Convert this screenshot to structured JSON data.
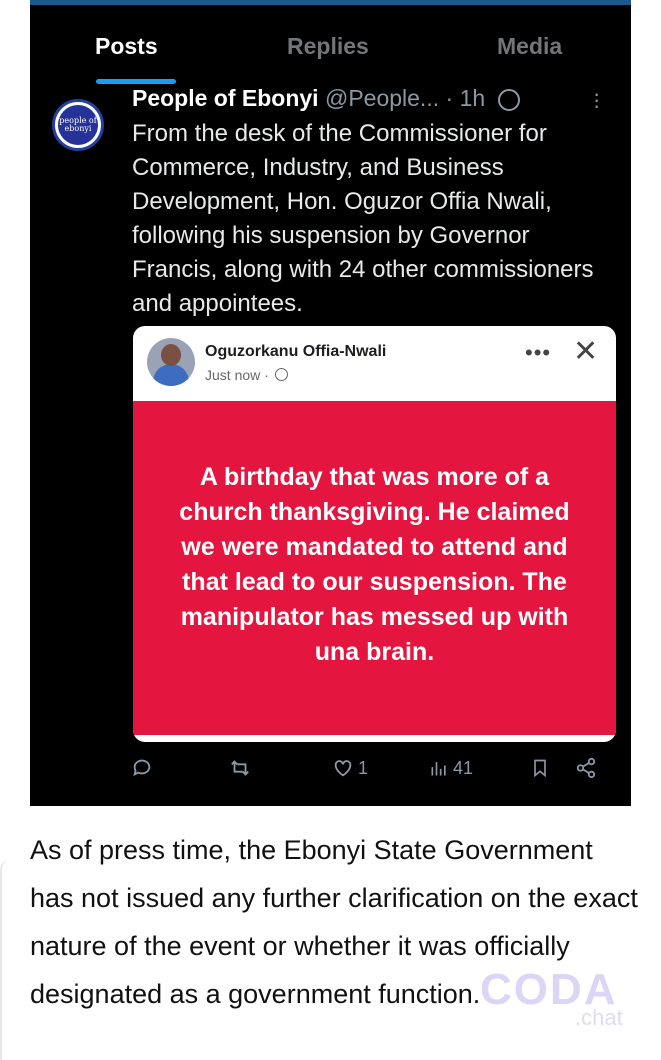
{
  "tabs": [
    {
      "label": "Posts",
      "active": true
    },
    {
      "label": "Replies",
      "active": false
    },
    {
      "label": "Media",
      "active": false
    }
  ],
  "post": {
    "avatar_text": "people of ebonyi",
    "author_name": "People of Ebonyi",
    "author_handle": "@People...",
    "separator": "·",
    "time": "1h",
    "body": "From the desk of the Commissioner for Commerce, Industry, and Business Development, Hon. Oguzor Offia Nwali, following his suspension by Governor Francis, along with 24 other commissioners and appointees.",
    "embedded": {
      "name": "Oguzorkanu Offia-Nwali",
      "time": "Just now ·",
      "dots": "•••",
      "close": "✕",
      "message": "A birthday that was more of a church thanksgiving. He claimed we were mandated to attend and that lead to our suspension. The manipulator has messed up with una brain.",
      "bg_color": "#e4153e"
    },
    "actions": {
      "reply_icon": "reply-icon",
      "retweet_icon": "retweet-icon",
      "like_count": "1",
      "views_count": "41",
      "bookmark_icon": "bookmark-icon",
      "share_icon": "share-icon"
    }
  },
  "article_text": "As of press time, the Ebonyi State Government has not issued any further clarification on the exact nature of the event or whether it was officially designated as a government function.",
  "watermark": {
    "line1": "CODA",
    "line2": ".chat"
  }
}
